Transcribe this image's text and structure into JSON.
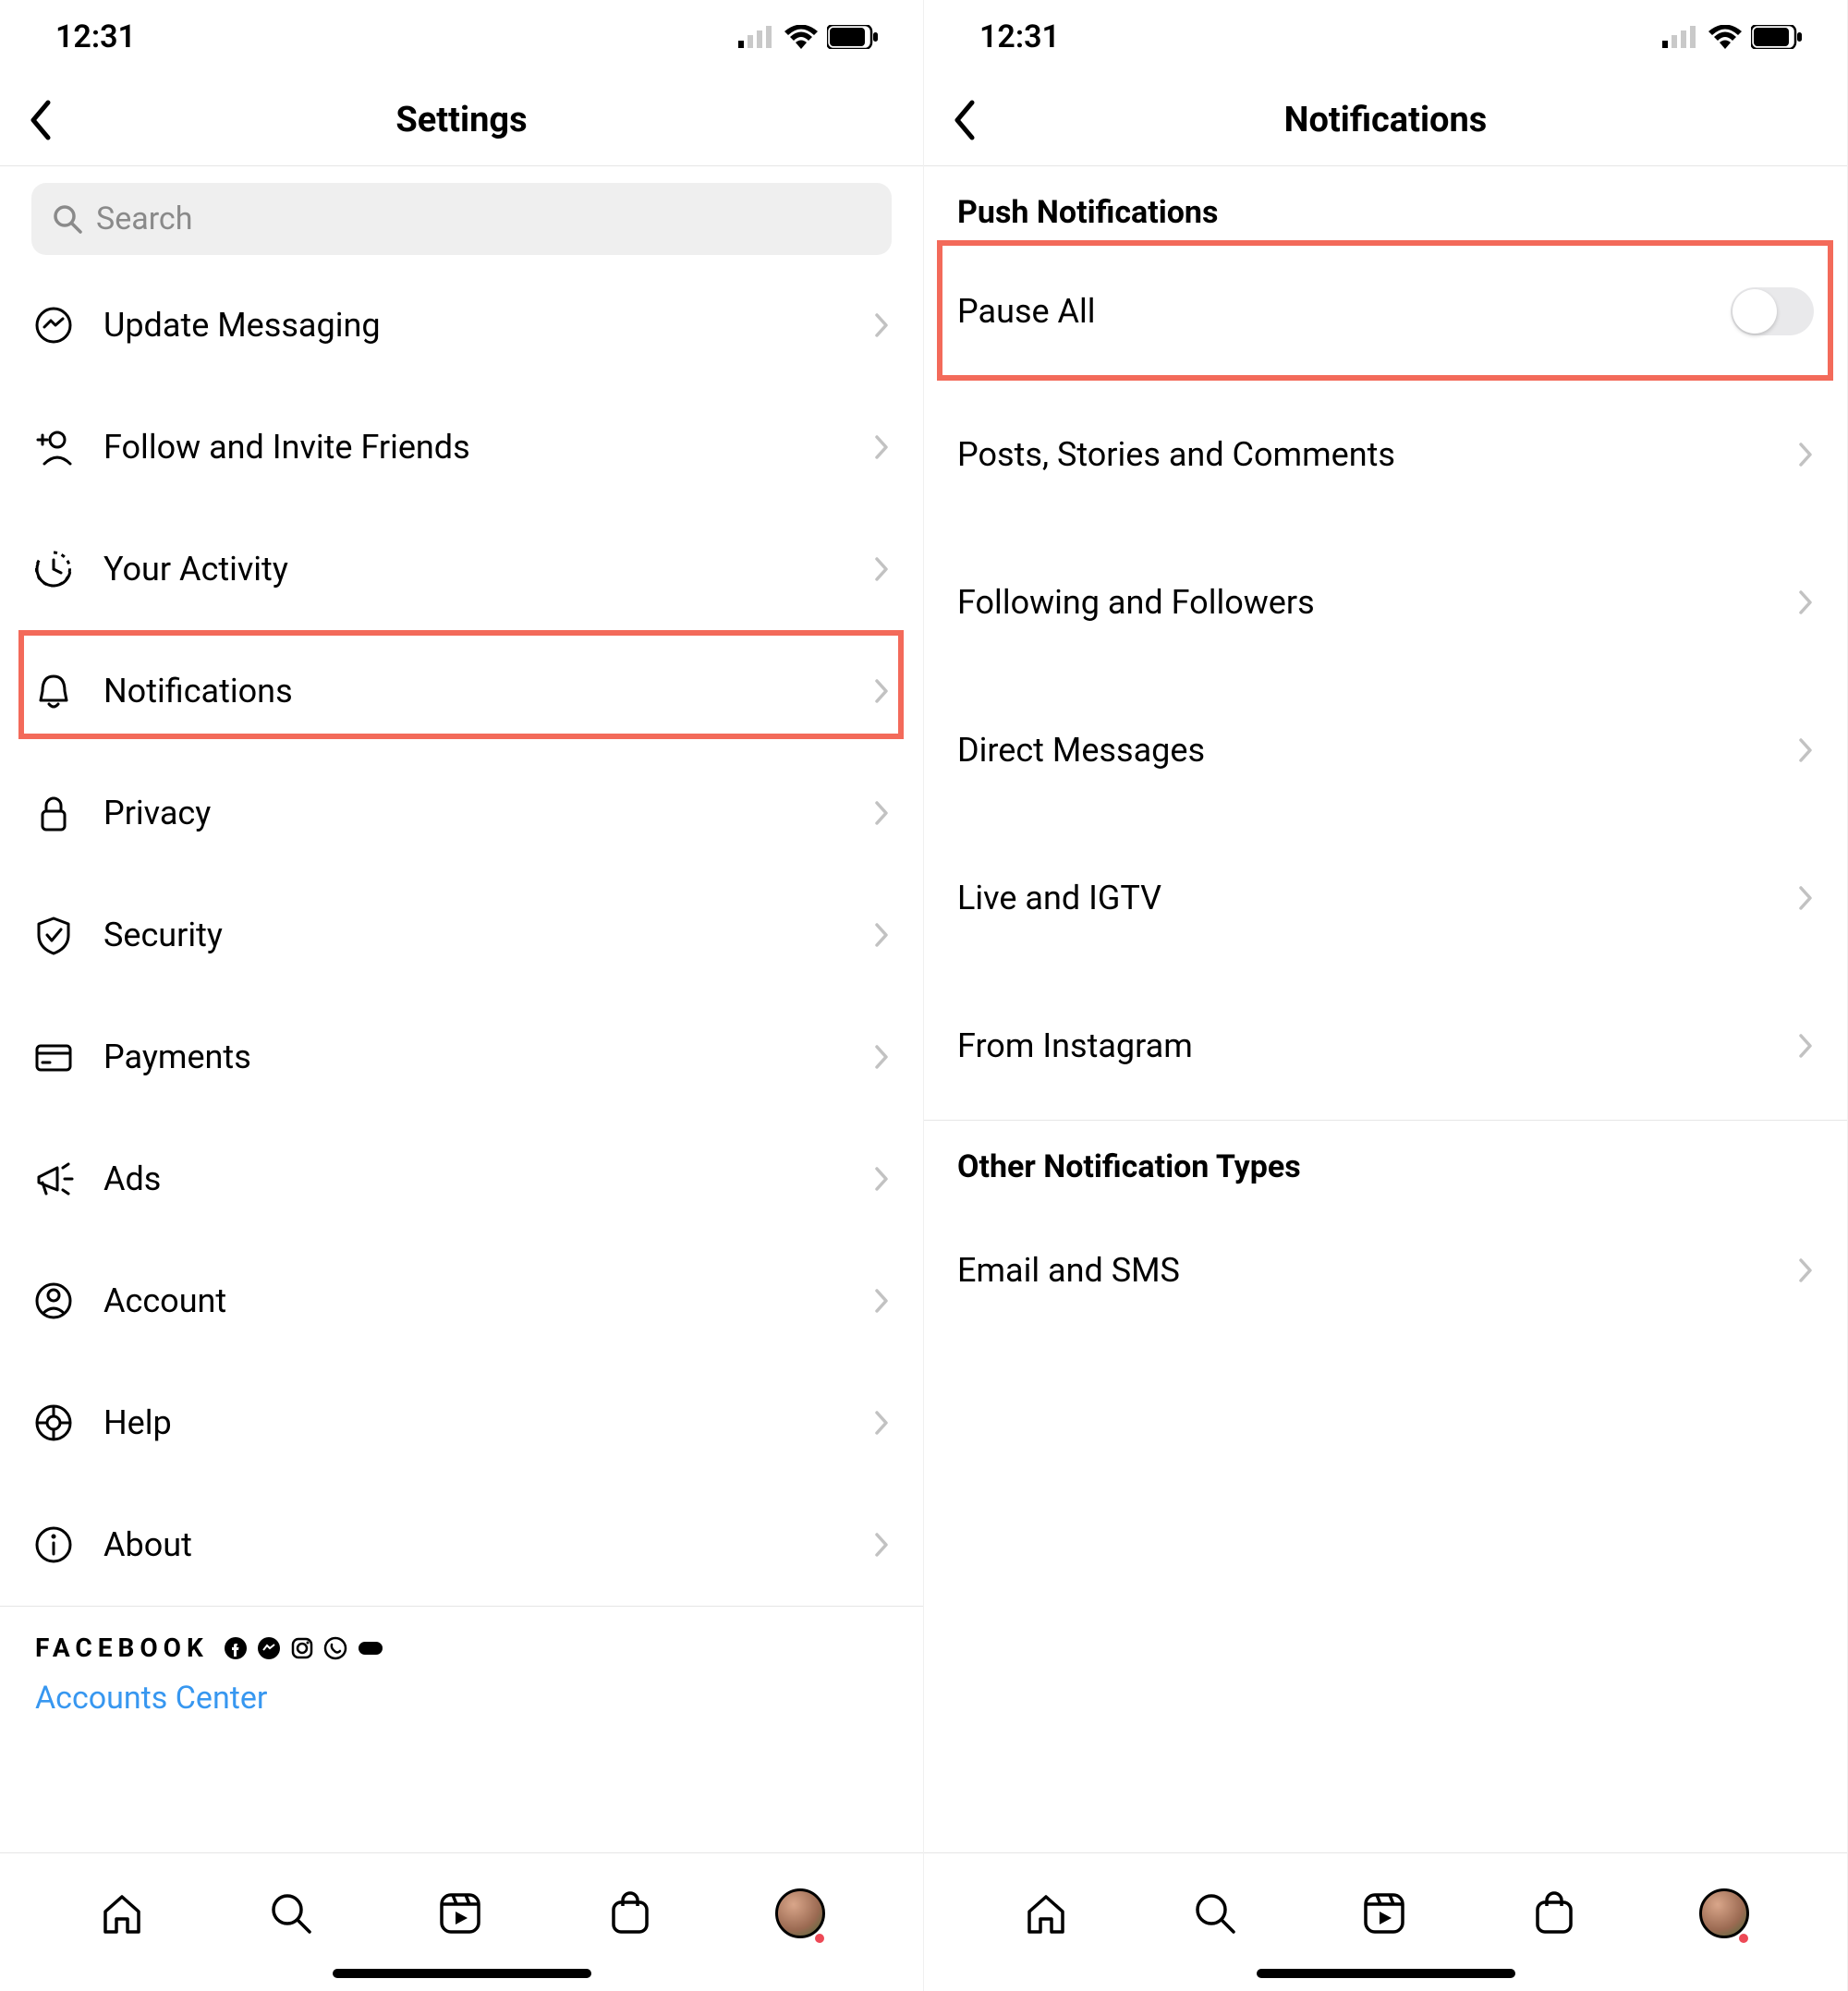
{
  "status": {
    "time": "12:31"
  },
  "left": {
    "title": "Settings",
    "search_placeholder": "Search",
    "items": [
      {
        "label": "Update Messaging"
      },
      {
        "label": "Follow and Invite Friends"
      },
      {
        "label": "Your Activity"
      },
      {
        "label": "Notifications"
      },
      {
        "label": "Privacy"
      },
      {
        "label": "Security"
      },
      {
        "label": "Payments"
      },
      {
        "label": "Ads"
      },
      {
        "label": "Account"
      },
      {
        "label": "Help"
      },
      {
        "label": "About"
      }
    ],
    "fb_brand": "FACEBOOK",
    "accounts_center": "Accounts Center"
  },
  "right": {
    "title": "Notifications",
    "push_header": "Push Notifications",
    "pause_all": "Pause All",
    "push_items": [
      {
        "label": "Posts, Stories and Comments"
      },
      {
        "label": "Following and Followers"
      },
      {
        "label": "Direct Messages"
      },
      {
        "label": "Live and IGTV"
      },
      {
        "label": "From Instagram"
      }
    ],
    "other_header": "Other Notification Types",
    "other_items": [
      {
        "label": "Email and SMS"
      }
    ]
  }
}
